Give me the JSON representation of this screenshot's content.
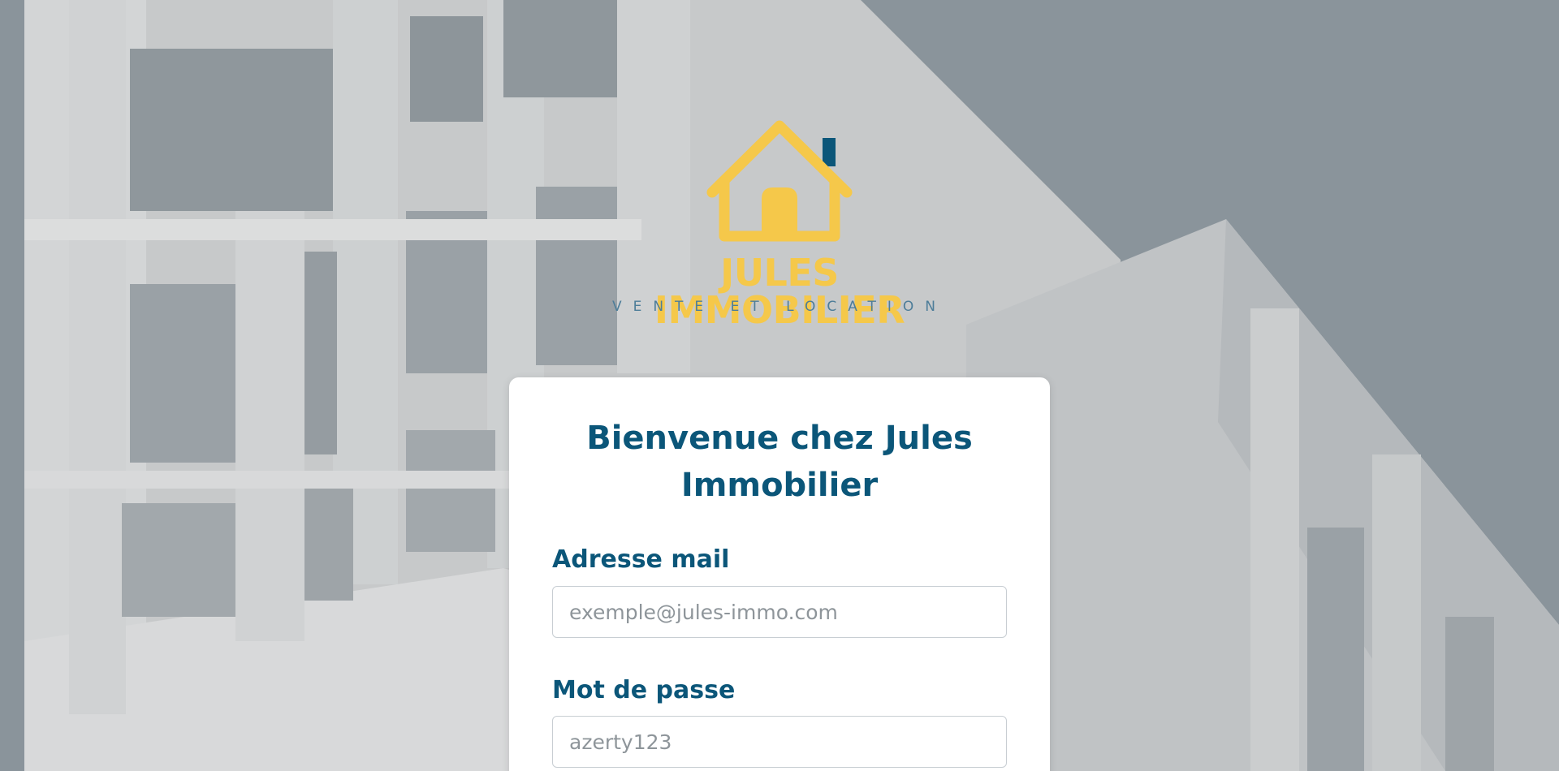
{
  "brand": {
    "name": "JULES IMMOBILIER",
    "tagline": "VENTE ET LOCATION",
    "logo_color": "#f5c84a",
    "chimney_color": "#0b5679"
  },
  "login": {
    "title": "Bienvenue chez Jules Immobilier",
    "email": {
      "label": "Adresse mail",
      "placeholder": "exemple@jules-immo.com"
    },
    "password": {
      "label": "Mot de passe",
      "placeholder": "azerty123"
    }
  },
  "colors": {
    "title": "#0b5679",
    "card_background": "#ffffff",
    "page_background": "#8a949b"
  },
  "icons": {
    "logo": "house-icon"
  }
}
